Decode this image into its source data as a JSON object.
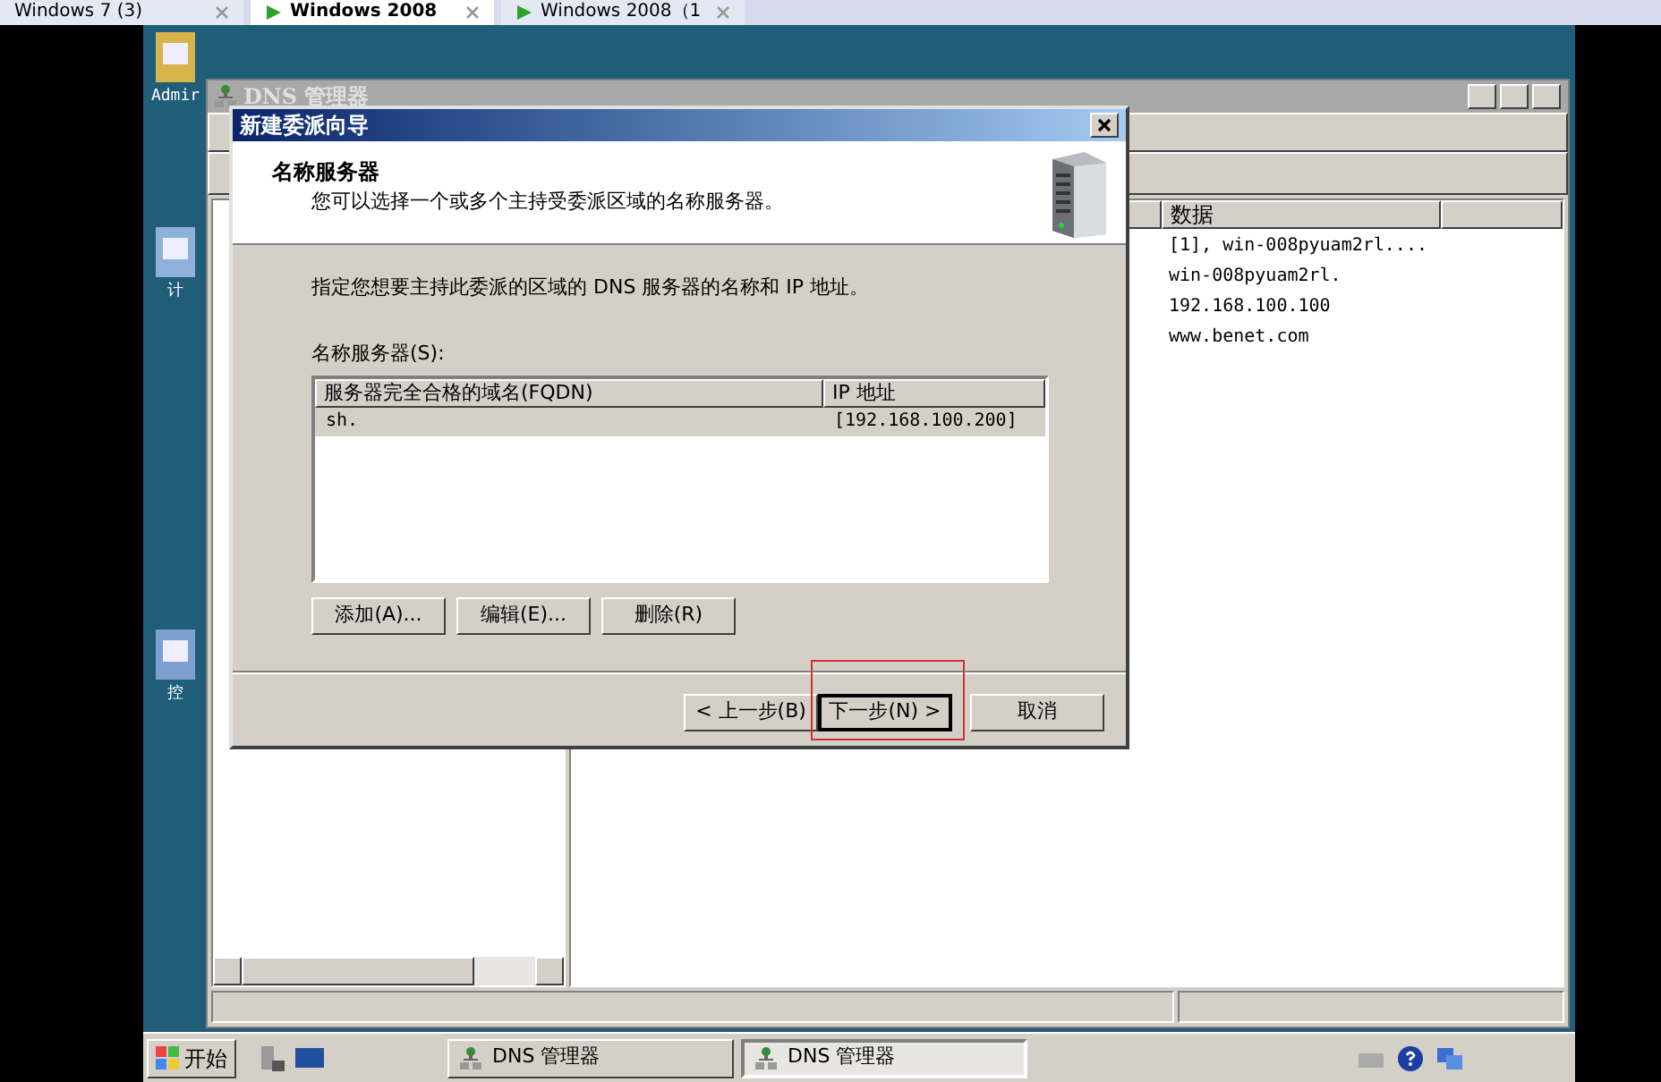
{
  "browser_tabs": [
    {
      "label": "Windows 7 (3)",
      "selected": false
    },
    {
      "label": "Windows 2008",
      "selected": true
    },
    {
      "label": "Windows 2008（1",
      "selected": false
    }
  ],
  "desktop_icons": [
    {
      "label": "Admir"
    },
    {
      "label": "计"
    },
    {
      "label": "控"
    }
  ],
  "dns_window": {
    "title": "DNS 管理器",
    "data_column": "数据",
    "data_rows": [
      "[1], win-008pyuam2rl....",
      "win-008pyuam2rl.",
      "192.168.100.100",
      "www.benet.com"
    ]
  },
  "dialog": {
    "title": "新建委派向导",
    "heading": "名称服务器",
    "subtitle": "您可以选择一个或多个主持受委派区域的名称服务器。",
    "instruction": "指定您想要主持此委派的区域的 DNS 服务器的名称和 IP 地址。",
    "list_label": "名称服务器(S):",
    "columns": [
      "服务器完全合格的域名(FQDN)",
      "IP 地址"
    ],
    "rows": [
      {
        "cells": [
          "sh.",
          "[192.168.100.200]"
        ],
        "selected": true
      }
    ],
    "list_buttons": [
      "添加(A)...",
      "编辑(E)...",
      "删除(R)"
    ],
    "nav_buttons": [
      {
        "label": "< 上一步(B)",
        "highlighted": false
      },
      {
        "label": "下一步(N) >",
        "highlighted": true
      },
      {
        "label": "取消",
        "highlighted": false
      }
    ]
  },
  "taskbar": {
    "start": "开始",
    "tasks": [
      {
        "label": "DNS 管理器",
        "selected": false
      },
      {
        "label": "DNS 管理器",
        "selected": true
      }
    ]
  }
}
